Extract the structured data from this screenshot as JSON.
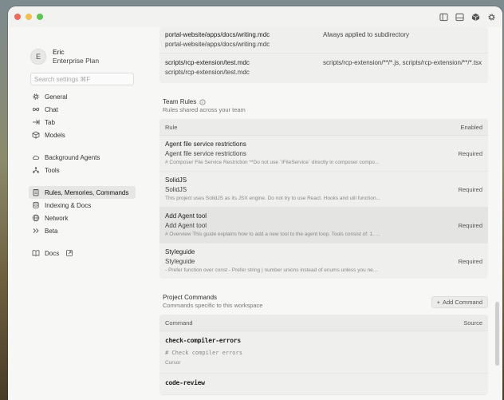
{
  "titlebar": {
    "traffic_colors": [
      "#ed6a5e",
      "#f5bf4f",
      "#61c554"
    ],
    "icons": [
      "sidebar-left-icon",
      "panel-bottom-icon",
      "cube-icon",
      "gear-icon"
    ]
  },
  "sidebar": {
    "avatar_letter": "E",
    "user_name": "Eric",
    "plan": "Enterprise Plan",
    "search_placeholder": "Search settings ⌘F",
    "groups": [
      [
        {
          "label": "General",
          "icon": "gear-icon"
        },
        {
          "label": "Chat",
          "icon": "infinity-icon"
        },
        {
          "label": "Tab",
          "icon": "tab-arrow-icon"
        },
        {
          "label": "Models",
          "icon": "cube-icon"
        }
      ],
      [
        {
          "label": "Background Agents",
          "icon": "cloud-icon"
        },
        {
          "label": "Tools",
          "icon": "tools-icon"
        }
      ],
      [
        {
          "label": "Rules, Memories, Commands",
          "icon": "clipboard-icon",
          "active": true
        },
        {
          "label": "Indexing & Docs",
          "icon": "database-icon"
        },
        {
          "label": "Network",
          "icon": "globe-icon"
        },
        {
          "label": "Beta",
          "icon": "chevrons-icon"
        }
      ],
      [
        {
          "label": "Docs",
          "icon": "book-icon",
          "external": true
        }
      ]
    ]
  },
  "top_rules": [
    {
      "path": "portal-website/apps/docs/writing.mdc",
      "path2": "portal-website/apps/docs/writing.mdc",
      "applies": "Always applied to subdirectory"
    },
    {
      "path": "scripts/rcp-extension/test.mdc",
      "path2": "scripts/rcp-extension/test.mdc",
      "applies": "scripts/rcp-extension/**/*.js, scripts/rcp-extension/**/*.tsx"
    }
  ],
  "team_rules": {
    "title": "Team Rules",
    "subtitle": "Rules shared across your team",
    "col_rule": "Rule",
    "col_enabled": "Enabled",
    "rows": [
      {
        "title": "Agent file service restrictions",
        "subtitle": "Agent file service restrictions",
        "preview": "# Composer File Service Restriction **Do not use `IFileService` directly in composer compo...",
        "status": "Required"
      },
      {
        "title": "SolidJS",
        "subtitle": "SolidJS",
        "preview": "This project uses SolidJS as its JSX engine. Do not try to use React. Hooks and util function...",
        "status": "Required"
      },
      {
        "title": "Add Agent tool",
        "subtitle": "Add Agent tool",
        "preview": "# Overview This guide explains how to add a new tool to the agent loop. Tools consist of: 1. ...",
        "status": "Required",
        "highlight": true
      },
      {
        "title": "Styleguide",
        "subtitle": "Styleguide",
        "preview": "- Prefer function over const - Prefer string | number unions instead of enums unless you ne...",
        "status": "Required"
      }
    ]
  },
  "project_commands": {
    "title": "Project Commands",
    "subtitle": "Commands specific to this workspace",
    "add_label": "Add Command",
    "col_command": "Command",
    "col_source": "Source",
    "rows": [
      {
        "name": "check-compiler-errors",
        "code": "# Check compiler errors",
        "source": "Cursor"
      },
      {
        "name": "code-review",
        "code": "",
        "source": ""
      }
    ]
  }
}
